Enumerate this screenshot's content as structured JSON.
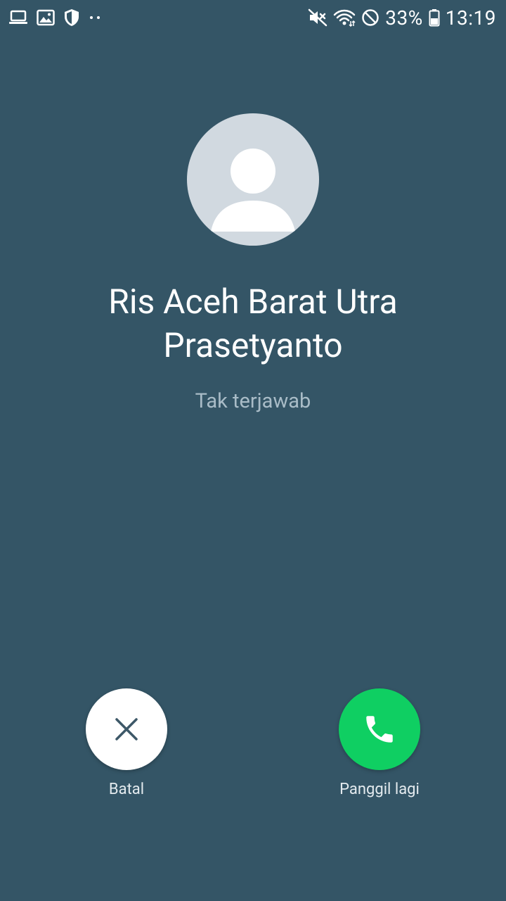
{
  "status_bar": {
    "left_icons": [
      "laptop-icon",
      "image-icon",
      "shield-icon",
      "more-dots-icon"
    ],
    "right_icons": [
      "mute-icon",
      "wifi-icon",
      "block-icon",
      "battery-icon"
    ],
    "battery": "33%",
    "time": "13:19"
  },
  "call": {
    "caller_name_line1": "Ris Aceh Barat Utra",
    "caller_name_line2": "Prasetyanto",
    "status": "Tak terjawab"
  },
  "actions": {
    "cancel_label": "Batal",
    "redial_label": "Panggil lagi"
  },
  "colors": {
    "background": "#345566",
    "avatar_bg": "#d1d9e0",
    "redial_green": "#0fcf62",
    "status_text": "#a9bcc7"
  }
}
